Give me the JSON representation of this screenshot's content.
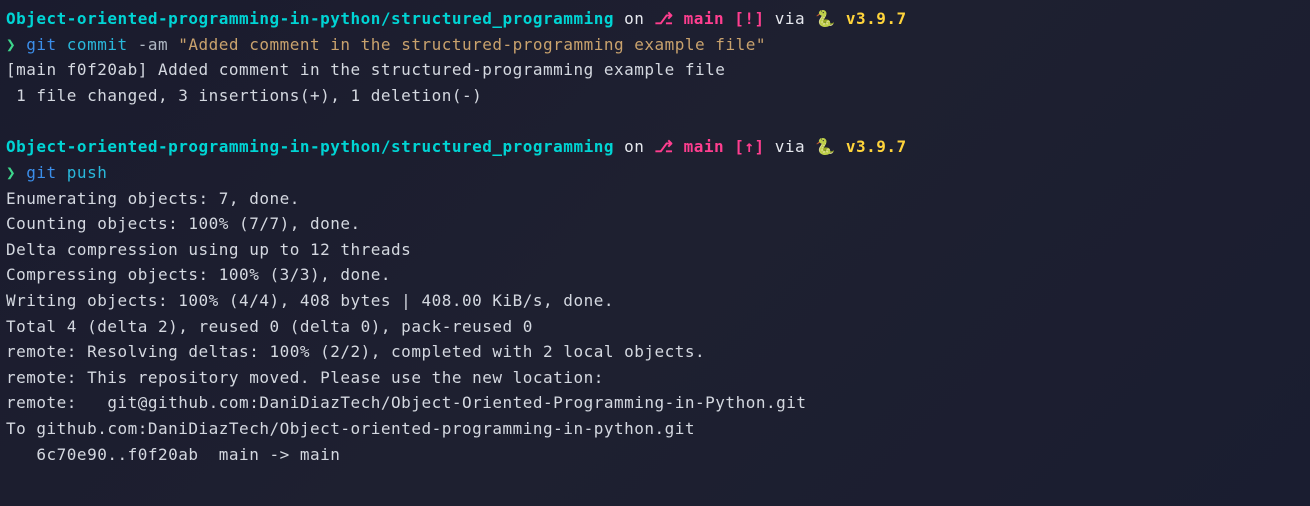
{
  "prompt1": {
    "path": "Object-oriented-programming-in-python/structured_programming",
    "on": " on ",
    "branch_icon": "⎇",
    "branch": " main ",
    "status": "[!]",
    "via": " via ",
    "snake": "🐍 ",
    "version": "v3.9.7"
  },
  "cmd1": {
    "prompt": "❯ ",
    "git": "git ",
    "sub": "commit ",
    "flag": "-am ",
    "msg": "\"Added comment in the structured-programming example file\""
  },
  "out1": {
    "l1": "[main f0f20ab] Added comment in the structured-programming example file",
    "l2": " 1 file changed, 3 insertions(+), 1 deletion(-)"
  },
  "prompt2": {
    "path": "Object-oriented-programming-in-python/structured_programming",
    "on": " on ",
    "branch_icon": "⎇",
    "branch": " main ",
    "status": "[↑]",
    "via": " via ",
    "snake": "🐍 ",
    "version": "v3.9.7"
  },
  "cmd2": {
    "prompt": "❯ ",
    "git": "git ",
    "sub": "push"
  },
  "out2": {
    "l1": "Enumerating objects: 7, done.",
    "l2": "Counting objects: 100% (7/7), done.",
    "l3": "Delta compression using up to 12 threads",
    "l4": "Compressing objects: 100% (3/3), done.",
    "l5": "Writing objects: 100% (4/4), 408 bytes | 408.00 KiB/s, done.",
    "l6": "Total 4 (delta 2), reused 0 (delta 0), pack-reused 0",
    "l7": "remote: Resolving deltas: 100% (2/2), completed with 2 local objects.",
    "l8": "remote: This repository moved. Please use the new location:",
    "l9": "remote:   git@github.com:DaniDiazTech/Object-Oriented-Programming-in-Python.git",
    "l10": "To github.com:DaniDiazTech/Object-oriented-programming-in-python.git",
    "l11": "   6c70e90..f0f20ab  main -> main"
  }
}
